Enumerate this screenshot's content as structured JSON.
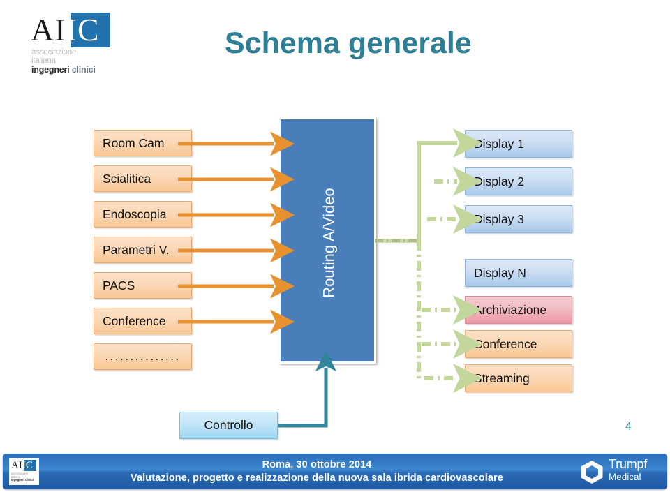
{
  "slide": {
    "title": "Schema generale",
    "page_number": "4",
    "background_color": "#ffffff"
  },
  "logo": {
    "letters_dark": "AI",
    "letters_light": "IC",
    "line1": "associazione",
    "line2": "italiana",
    "line3_bold": "ingegneri",
    "line3_gray": "clinici",
    "box_color": "#2273ad"
  },
  "diagram": {
    "sources": [
      {
        "label": "Room Cam"
      },
      {
        "label": "Scialitica"
      },
      {
        "label": "Endoscopia"
      },
      {
        "label": "Parametri V."
      },
      {
        "label": "PACS"
      },
      {
        "label": "Conference"
      },
      {
        "label": "..............."
      }
    ],
    "router": {
      "label": "Routing A/Video",
      "color": "#4a7ebb",
      "text_color": "#ffffff"
    },
    "outputs": [
      {
        "label": "Display 1",
        "style": "display",
        "color": "#cfe0f4"
      },
      {
        "label": "Display  2",
        "style": "display",
        "color": "#cfe0f4"
      },
      {
        "label": "Display  3",
        "style": "display",
        "color": "#cfe0f4"
      },
      {
        "label": "Display  N",
        "style": "display",
        "color": "#cfe0f4"
      },
      {
        "label": "Archiviazione",
        "style": "archive",
        "color": "#f2bcc4"
      },
      {
        "label": "Conference",
        "style": "source-orange",
        "color": "#fbd8b6"
      },
      {
        "label": "Streaming",
        "style": "source-orange",
        "color": "#fbd8b6"
      }
    ],
    "control": {
      "label": "Controllo",
      "color": "#c2e6f8"
    },
    "connector_colors": {
      "input_arrows": "#e8922f",
      "output_arrows": "#c3d69b",
      "control_arrow": "#31869b"
    }
  },
  "footer": {
    "line1": "Roma, 30 ottobre 2014",
    "line2": "Valutazione, progetto  e realizzazione della nuova sala ibrida cardiovascolare",
    "background_color": "#2f74c0",
    "brand": {
      "name": "Trumpf",
      "subtitle": "Medical",
      "icon": "hexagon-cube-icon"
    },
    "logo": {
      "letters_dark": "AI",
      "letters_light": "IC",
      "sub_line1": "associazione",
      "sub_line2": "italiana",
      "sub_line3": "ingegneri clinici"
    }
  }
}
